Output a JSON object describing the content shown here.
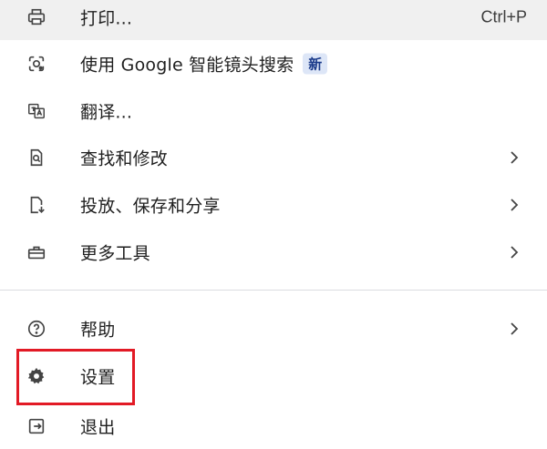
{
  "menu": {
    "items": [
      {
        "label": "打印...",
        "shortcut": "Ctrl+P",
        "icon": "printer-icon"
      },
      {
        "label": "使用 Google 智能镜头搜索",
        "badge": "新",
        "icon": "lens-icon"
      },
      {
        "label": "翻译...",
        "icon": "translate-icon"
      },
      {
        "label": "查找和修改",
        "icon": "find-page-icon"
      },
      {
        "label": "投放、保存和分享",
        "icon": "cast-save-icon"
      },
      {
        "label": "更多工具",
        "icon": "toolbox-icon"
      },
      {
        "label": "帮助",
        "icon": "help-icon"
      },
      {
        "label": "设置",
        "icon": "gear-icon"
      },
      {
        "label": "退出",
        "icon": "exit-icon"
      }
    ]
  },
  "colors": {
    "highlight_border": "#e21a25",
    "badge_bg": "#dde6f7",
    "hover_bg": "#f0f0f0"
  }
}
